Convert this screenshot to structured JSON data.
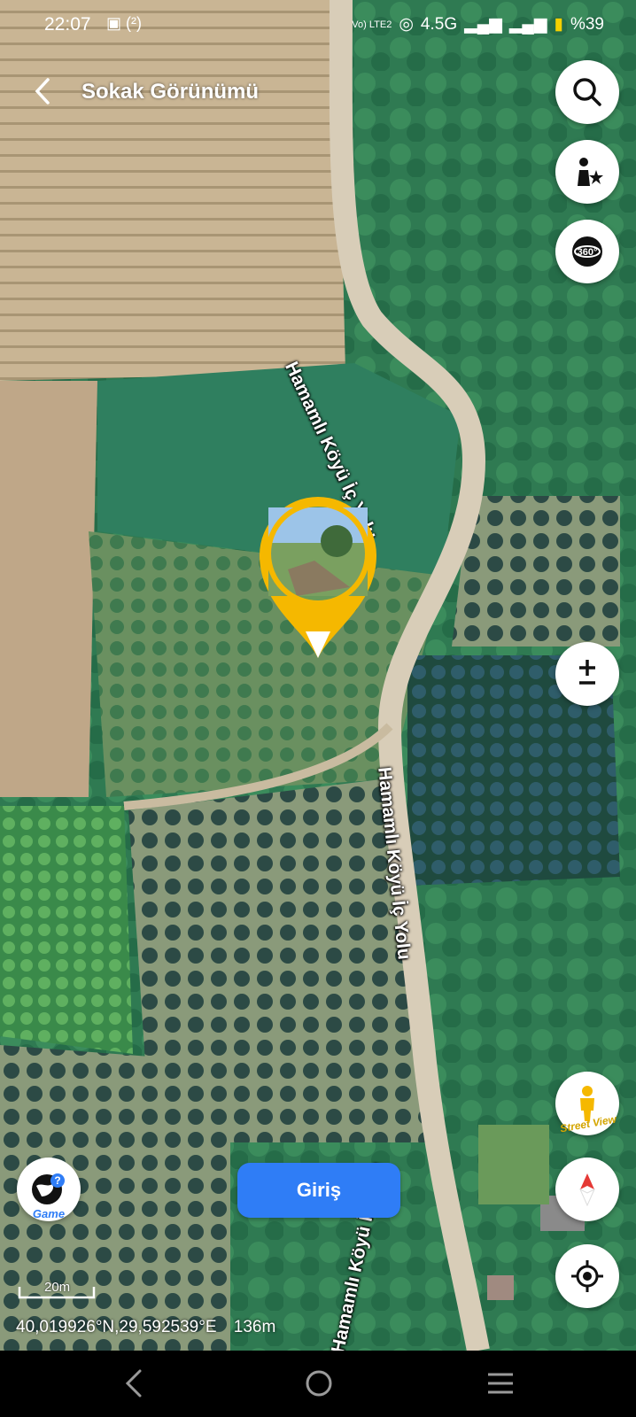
{
  "status_bar": {
    "time": "22:07",
    "notif_icons": "▣ (²)",
    "network": "Vo) LTE2",
    "signal_label": "4.5G",
    "battery": "%39"
  },
  "header": {
    "title": "Sokak Görünümü"
  },
  "map": {
    "road_labels": [
      "Hamamlı Köyü İç Yolu",
      "Hamamlı Köyü İç Yolu",
      "Hamamlı Köyü İç Yolu"
    ]
  },
  "buttons": {
    "enter": "Giriş",
    "game_label": "Game",
    "street_view_label": "Street View"
  },
  "scale_label": "20m",
  "coordinates": "40,019926°N,29,592539°E",
  "altitude": "136m",
  "colors": {
    "accent": "#2f7df6",
    "pin": "#f5b800"
  }
}
